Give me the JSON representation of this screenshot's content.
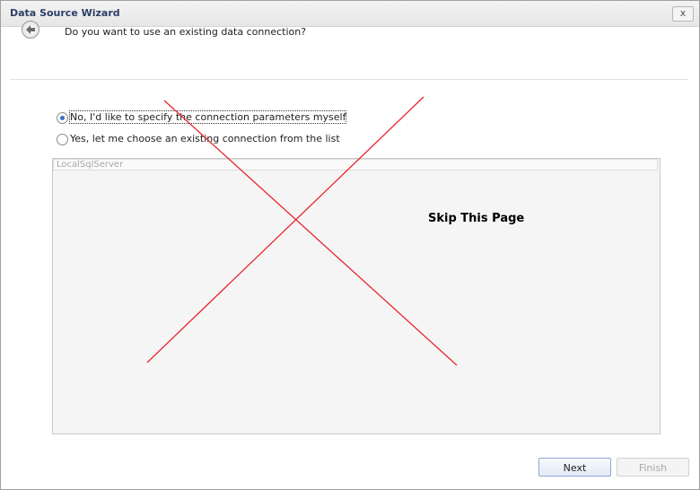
{
  "window": {
    "title": "Data Source Wizard",
    "close_label": "x"
  },
  "header": {
    "question": "Do you want to use an existing data connection?"
  },
  "options": [
    {
      "label": "No, I'd like to specify the connection parameters myself",
      "selected": true
    },
    {
      "label": "Yes, let me choose an existing connection from the list",
      "selected": false
    }
  ],
  "connections": {
    "items": [
      "LocalSqlServer"
    ]
  },
  "annotation": {
    "text": "Skip This Page",
    "color": "#e8262d"
  },
  "footer": {
    "next_label": "Next",
    "finish_label": "Finish"
  }
}
